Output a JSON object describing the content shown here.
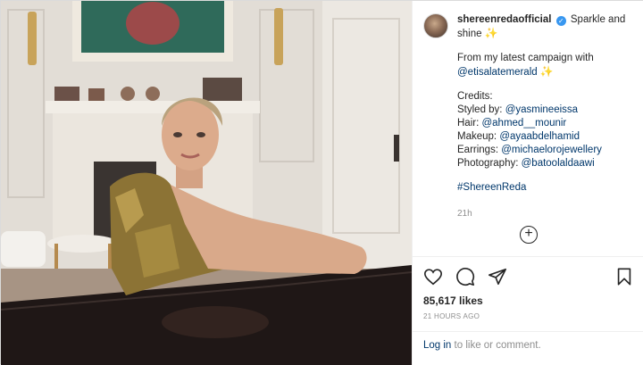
{
  "post": {
    "username": "shereenredaofficial",
    "caption_line1": "Sparkle and shine",
    "sparkle_glyph": "✨",
    "campaign_prefix": "From my latest campaign with",
    "campaign_mention": "@etisalatemerald",
    "credits_title": "Credits:",
    "styled_label": "Styled by:",
    "styled_handle": "@yasmineeissa",
    "hair_label": "Hair:",
    "hair_handle": "@ahmed__mounir",
    "makeup_label": "Makeup:",
    "makeup_handle": "@ayaabdelhamid",
    "earrings_label": "Earrings:",
    "earrings_handle": "@michaelorojewellery",
    "photo_label": "Photography:",
    "photo_handle": "@batoolaldaawi",
    "hashtag": "#ShereenReda",
    "caption_time": "21h",
    "likes": "85,617 likes",
    "time_ago": "21 HOURS AGO",
    "login_link": "Log in",
    "login_suffix": "to like or comment."
  },
  "icons": {
    "verified": "verified-badge-icon",
    "more": "plus-circle-icon",
    "like": "heart-icon",
    "comment": "comment-icon",
    "share": "paper-plane-icon",
    "save": "bookmark-icon"
  },
  "colors": {
    "link": "#00376b",
    "verified": "#3897f0",
    "muted": "#8e8e8e"
  }
}
